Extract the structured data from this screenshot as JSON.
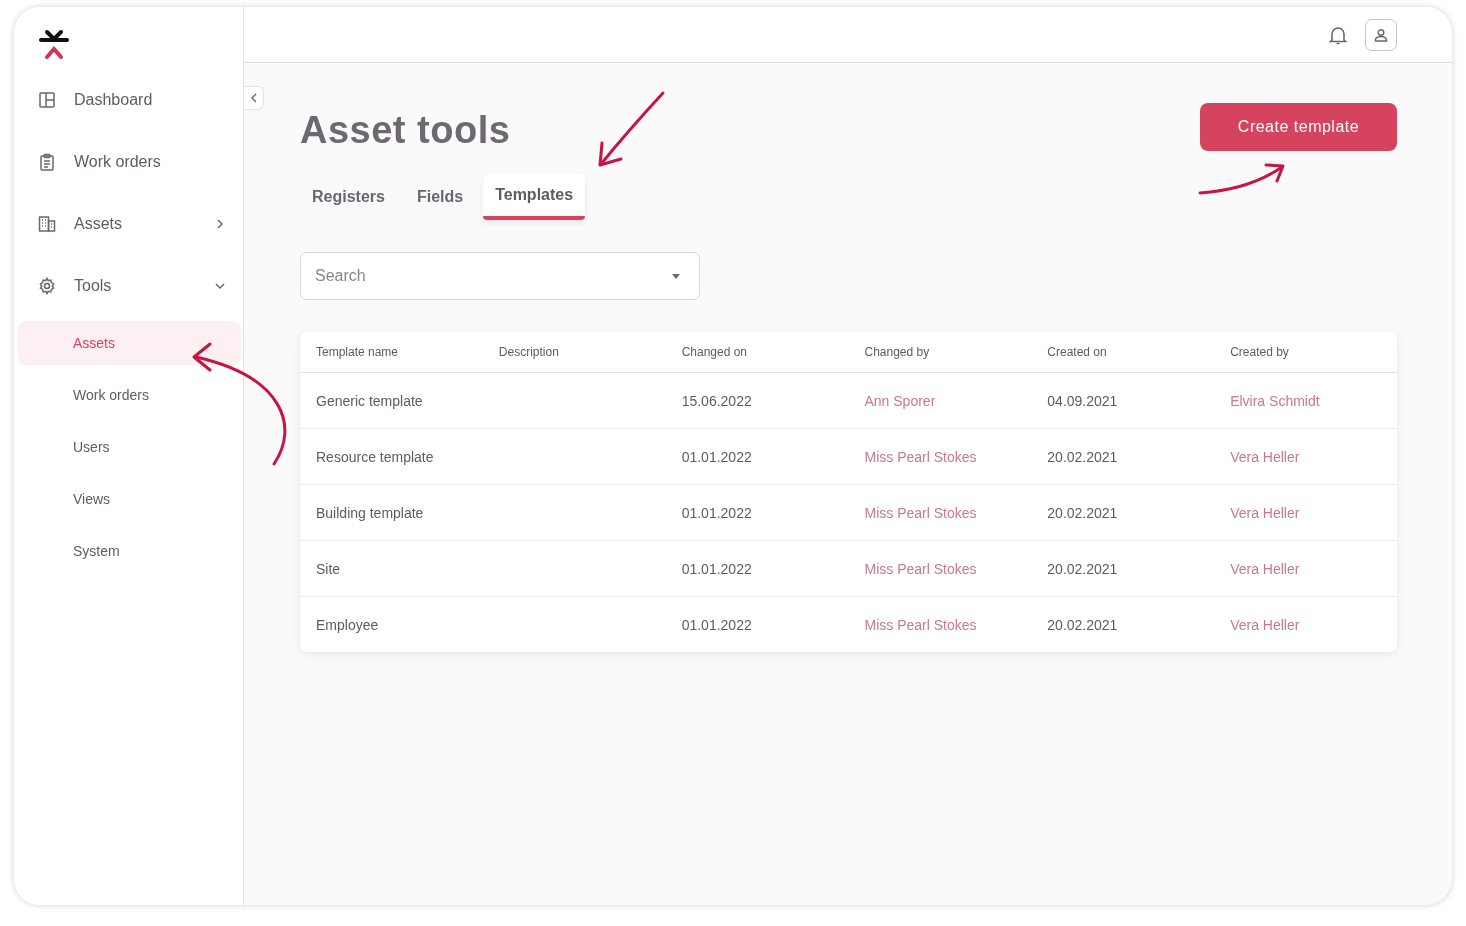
{
  "sidebar": {
    "items": [
      {
        "label": "Dashboard",
        "kind": "link"
      },
      {
        "label": "Work orders",
        "kind": "link"
      },
      {
        "label": "Assets",
        "kind": "group",
        "expanded": false
      },
      {
        "label": "Tools",
        "kind": "group",
        "expanded": true,
        "children": [
          {
            "label": "Assets",
            "selected": true
          },
          {
            "label": "Work orders",
            "selected": false
          },
          {
            "label": "Users",
            "selected": false
          },
          {
            "label": "Views",
            "selected": false
          },
          {
            "label": "System",
            "selected": false
          }
        ]
      }
    ]
  },
  "page": {
    "title": "Asset tools",
    "create_button": "Create template"
  },
  "tabs": [
    {
      "label": "Registers",
      "selected": false
    },
    {
      "label": "Fields",
      "selected": false
    },
    {
      "label": "Templates",
      "selected": true
    }
  ],
  "search": {
    "placeholder": "Search"
  },
  "table": {
    "columns": [
      "Template name",
      "Description",
      "Changed on",
      "Changed by",
      "Created on",
      "Created by"
    ],
    "rows": [
      [
        "Generic template",
        "",
        "15.06.2022",
        "Ann Sporer",
        "04.09.2021",
        "Elvira Schmidt"
      ],
      [
        "Resource template",
        "",
        "01.01.2022",
        "Miss Pearl Stokes",
        "20.02.2021",
        "Vera Heller"
      ],
      [
        "Building template",
        "",
        "01.01.2022",
        "Miss Pearl Stokes",
        "20.02.2021",
        "Vera Heller"
      ],
      [
        "Site",
        "",
        "01.01.2022",
        "Miss Pearl Stokes",
        "20.02.2021",
        "Vera Heller"
      ],
      [
        "Employee",
        "",
        "01.01.2022",
        "Miss Pearl Stokes",
        "20.02.2021",
        "Vera Heller"
      ]
    ]
  }
}
